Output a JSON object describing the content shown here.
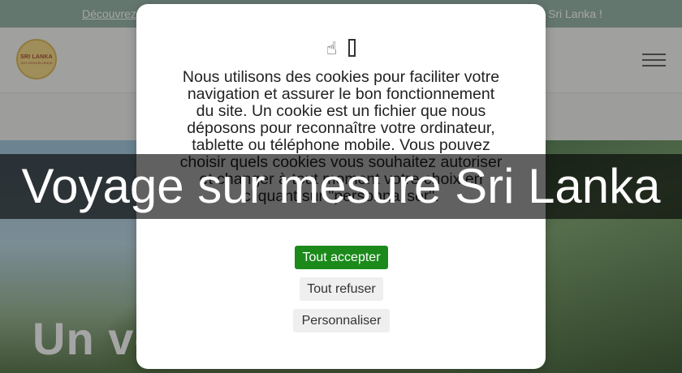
{
  "site": {
    "topbar_left": "Découvrez",
    "topbar_right": "Sri Lanka !",
    "logo": {
      "line1": "SRI LANKA",
      "line2": "VOY D'EXCELLENCE"
    },
    "hero_text": "Un vo"
  },
  "cookie_dialog": {
    "icons": [
      "hand-pointer-icon",
      "bracket-box-icon"
    ],
    "message": "Nous utilisons des cookies pour faciliter votre navigation et assurer le bon fonctionnement du site. Un cookie est un fichier que nous déposons pour reconnaître votre ordinateur, tablette ou téléphone mobile. Vous pouvez choisir quels cookies vous souhaitez autoriser et changer à tout moment votre choix en cliquant sur \"personnaliser\".",
    "accept_label": "Tout accepter",
    "refuse_label": "Tout refuser",
    "customize_label": "Personnaliser",
    "accept_color": "#1b8a1b"
  },
  "banner": {
    "title": "Voyage sur mesure Sri Lanka"
  }
}
